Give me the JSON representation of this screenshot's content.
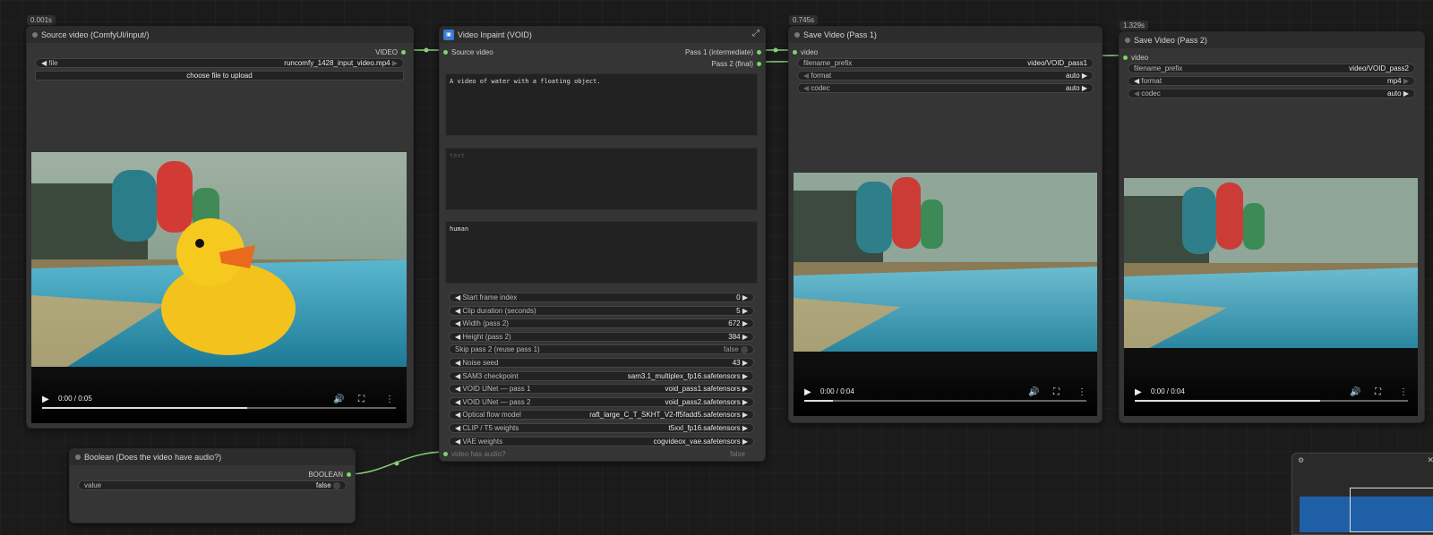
{
  "source_node": {
    "badge": "0.001s",
    "title": "Source video (ComfyUI/input/)",
    "out_label": "VIDEO",
    "file_label": "file",
    "file_value": "runcomfy_1428_input_video.mp4",
    "upload_label": "choose file to upload",
    "time": "0:00 / 0:05",
    "progress": 0.58
  },
  "inpaint_node": {
    "title": "Video Inpaint (VOID)",
    "in_label": "Source video",
    "out1": "Pass 1 (intermediate)",
    "out2": "Pass 2 (final)",
    "prompt_text": "A video of water with a floating object.",
    "text_placeholder": "text",
    "human_text": "human",
    "widgets": [
      {
        "label": "Start frame index",
        "value": "0"
      },
      {
        "label": "Clip duration (seconds)",
        "value": "5"
      },
      {
        "label": "Width (pass 2)",
        "value": "672"
      },
      {
        "label": "Height (pass 2)",
        "value": "384"
      },
      {
        "label": "Skip pass 2 (reuse pass 1)",
        "value": "false"
      },
      {
        "label": "Noise seed",
        "value": "43"
      },
      {
        "label": "SAM3 checkpoint",
        "value": "sam3.1_multiplex_fp16.safetensors"
      },
      {
        "label": "VOID UNet — pass 1",
        "value": "void_pass1.safetensors"
      },
      {
        "label": "VOID UNet — pass 2",
        "value": "void_pass2.safetensors"
      },
      {
        "label": "Optical flow model",
        "value": "raft_large_C_T_SKHT_V2-ff5fadd5.safetensors"
      },
      {
        "label": "CLIP / T5 weights",
        "value": "t5xxl_fp16.safetensors"
      },
      {
        "label": "VAE weights",
        "value": "cogvideox_vae.safetensors"
      }
    ],
    "audio_label": "video has audio?",
    "audio_value": "false"
  },
  "save1_node": {
    "badge": "0.745s",
    "title": "Save Video (Pass 1)",
    "in_label": "video",
    "prefix_label": "filename_prefix",
    "prefix_value": "video/VOID_pass1",
    "format_label": "format",
    "format_value": "auto",
    "codec_label": "codec",
    "codec_value": "auto",
    "time": "0:00 / 0:04",
    "progress": 0.1
  },
  "save2_node": {
    "badge": "1.329s",
    "title": "Save Video (Pass 2)",
    "in_label": "video",
    "prefix_label": "filename_prefix",
    "prefix_value": "video/VOID_pass2",
    "format_label": "format",
    "format_value": "mp4",
    "codec_label": "codec",
    "codec_value": "auto",
    "time": "0:00 / 0:04",
    "progress": 0.68
  },
  "bool_node": {
    "title": "Boolean (Does the video have audio?)",
    "out_label": "BOOLEAN",
    "value_label": "value",
    "value": "false"
  },
  "colors": {
    "wire": "#8ad07a",
    "port": "#7ad56a",
    "node_bg": "#353535",
    "title_bg": "#2c2c2c"
  }
}
